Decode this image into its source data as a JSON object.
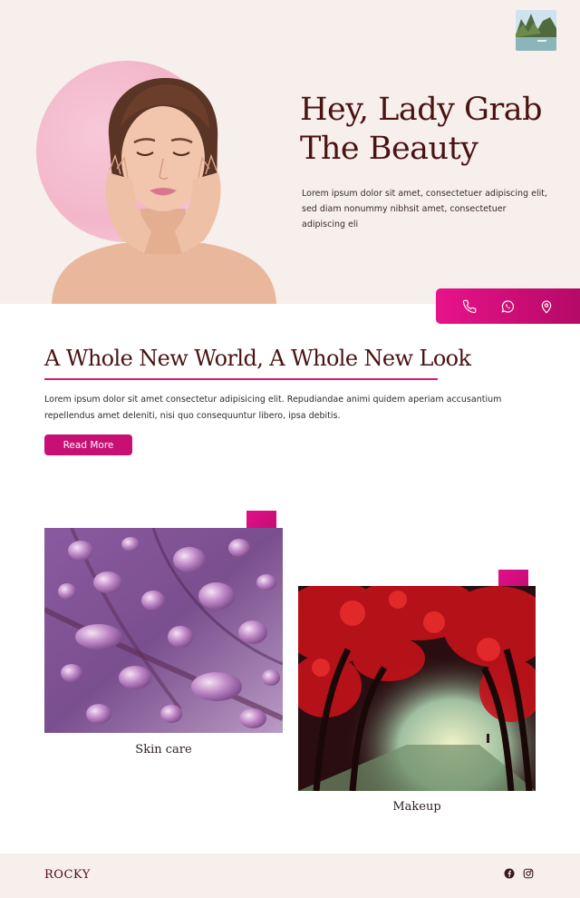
{
  "hero": {
    "title_line1": "Hey, Lady Grab",
    "title_line2": "The Beauty",
    "text": "Lorem ipsum dolor sit amet, consectetuer adipiscing elit, sed diam nonummy nibhsit amet, consectetuer adipiscing eli"
  },
  "contact": {
    "icons": [
      "phone-icon",
      "whatsapp-icon",
      "location-pin-icon"
    ]
  },
  "section": {
    "title": "A Whole New World, A Whole New Look",
    "text": "Lorem ipsum dolor sit amet consectetur adipisicing elit. Repudiandae animi quidem aperiam accusantium repellendus amet deleniti, nisi quo consequuntur libero, ipsa debitis.",
    "button_label": "Read More"
  },
  "cards": [
    {
      "caption": "Skin care"
    },
    {
      "caption": "Makeup"
    }
  ],
  "footer": {
    "brand": "ROCKY",
    "social": [
      "facebook-icon",
      "instagram-icon"
    ]
  },
  "colors": {
    "accent": "#c80f73",
    "heading": "#4a1212",
    "hero_bg": "#f7efec"
  }
}
